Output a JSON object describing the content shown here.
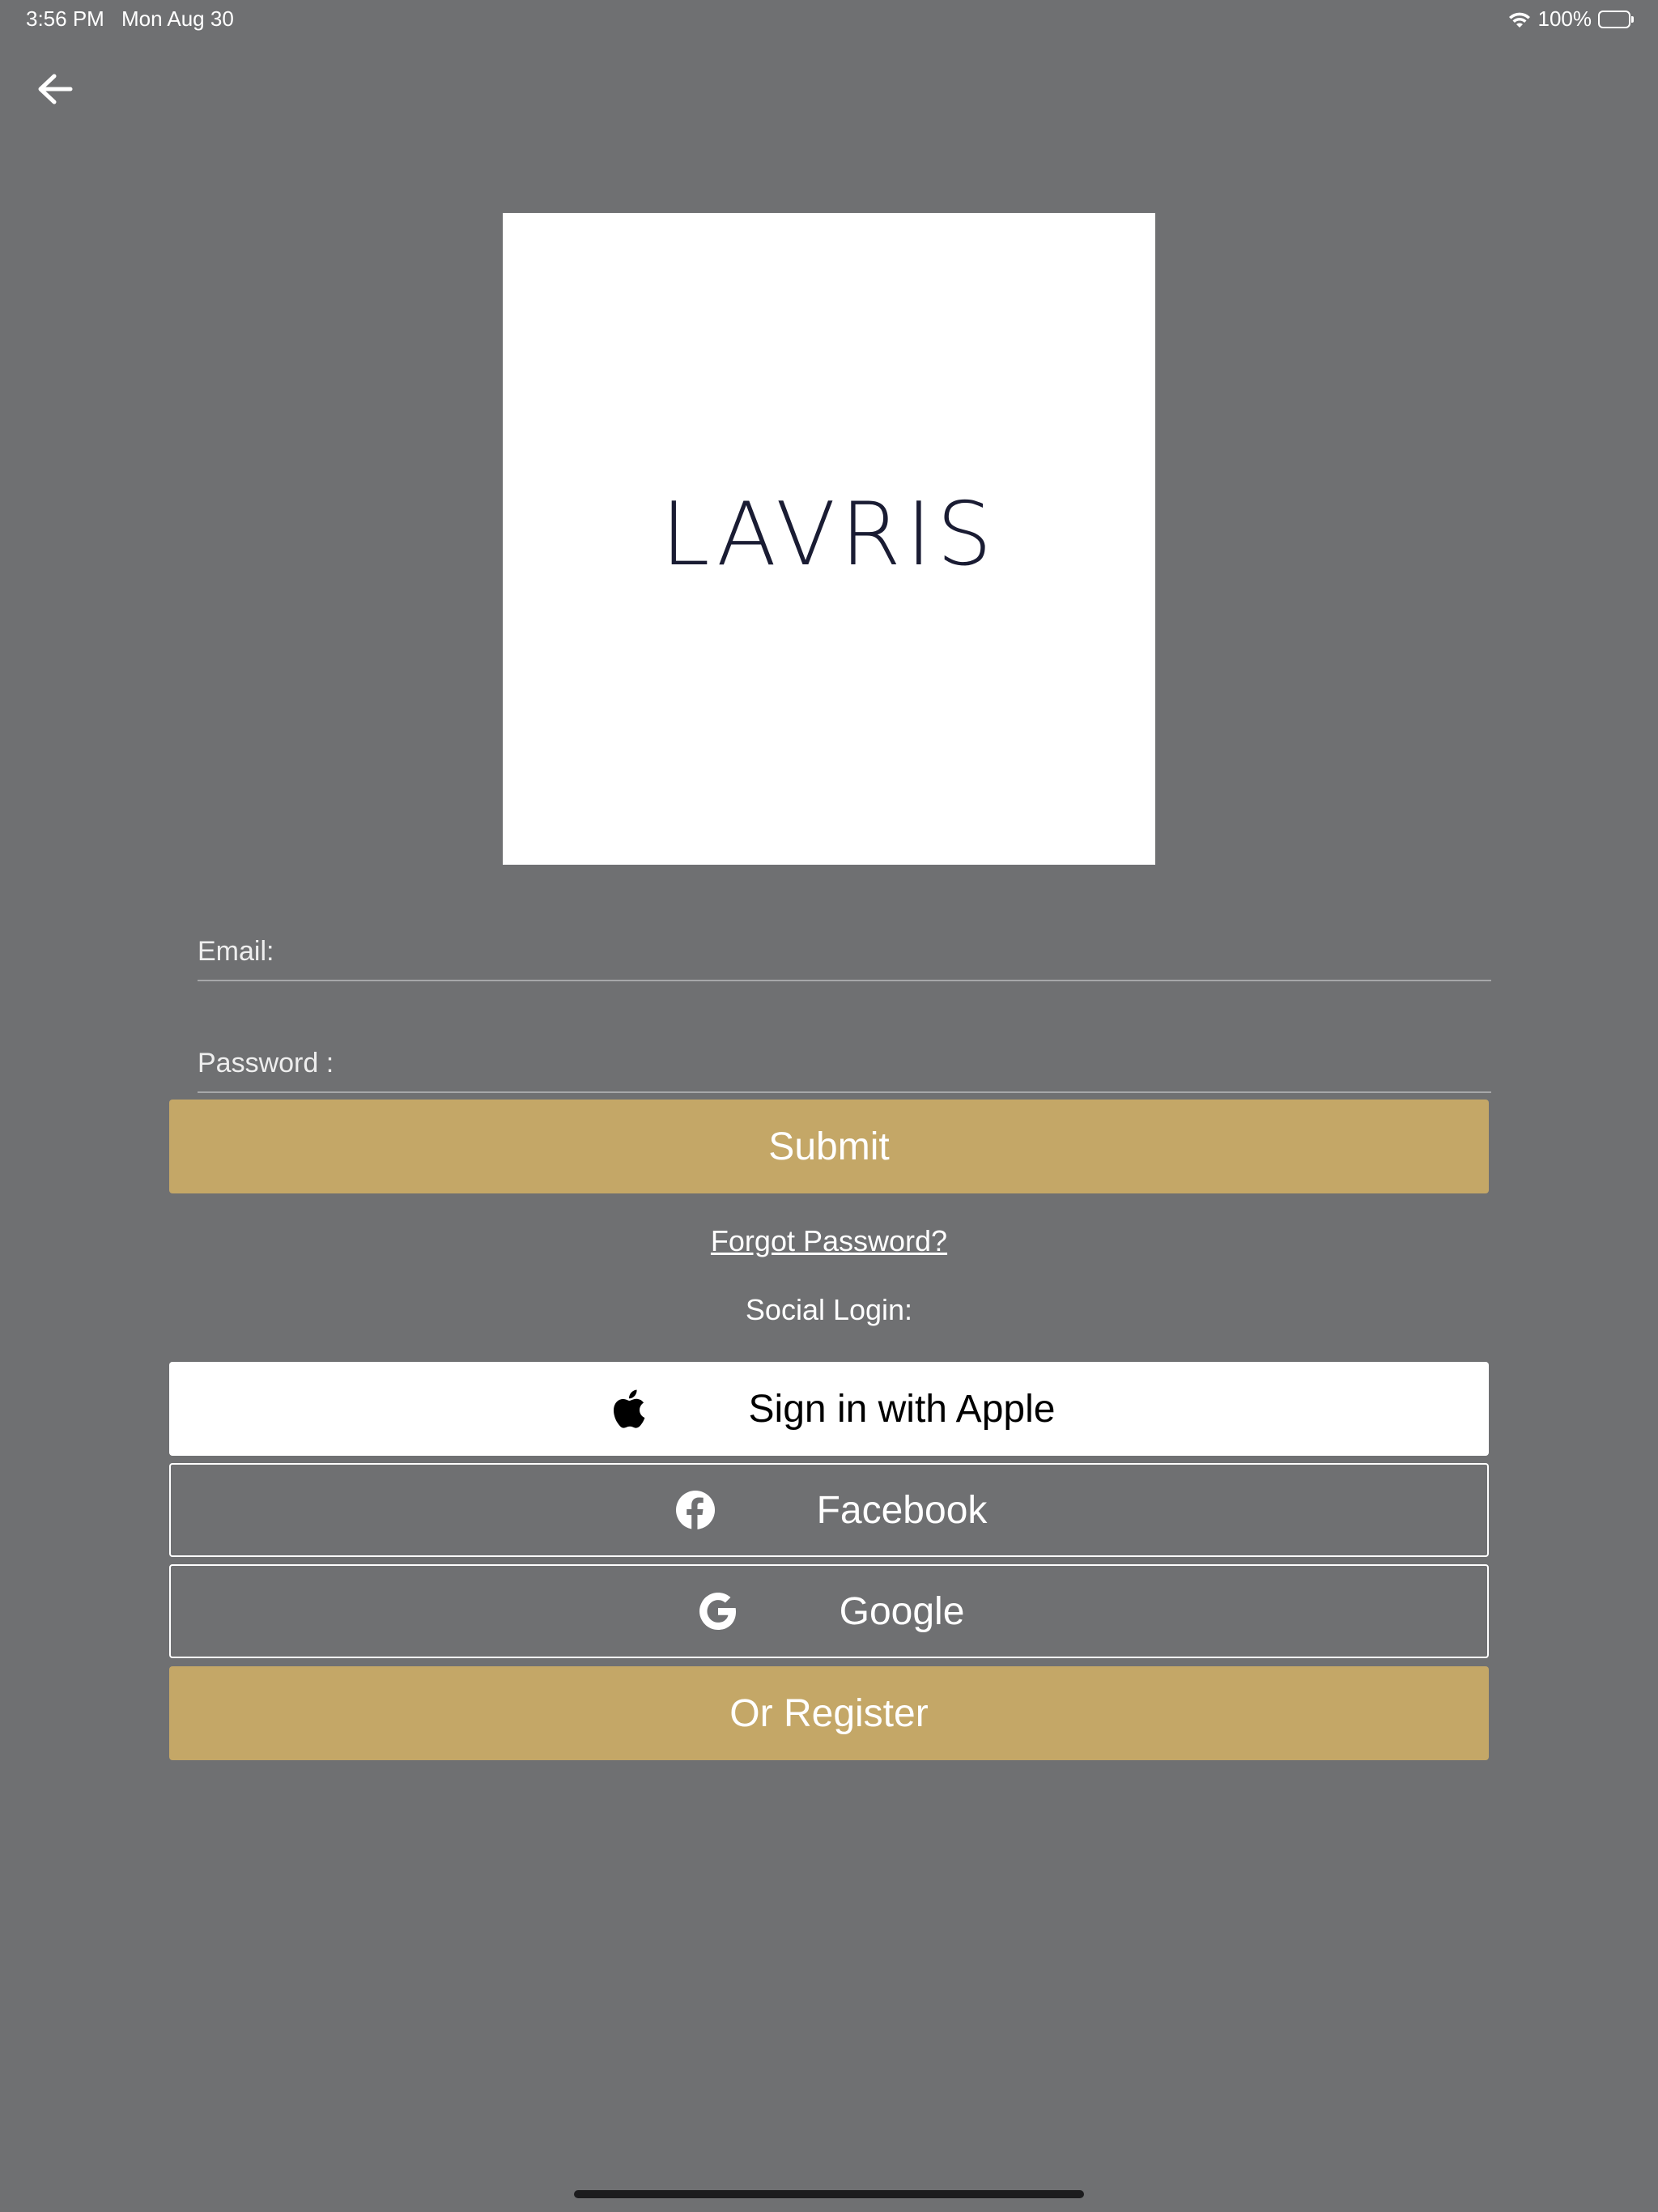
{
  "status_bar": {
    "time": "3:56 PM",
    "date": "Mon Aug 30",
    "battery": "100%",
    "wifi_icon": "wifi-icon",
    "battery_icon": "battery-icon"
  },
  "header": {
    "back_icon": "arrow-left-icon"
  },
  "logo": {
    "text": "LAVRIS"
  },
  "form": {
    "email_placeholder": "Email:",
    "email_value": "",
    "password_placeholder": "Password :",
    "password_value": "",
    "submit_label": "Submit",
    "forgot_password": "Forgot Password?"
  },
  "social": {
    "label": "Social Login:",
    "apple_label": "Sign in with Apple",
    "apple_icon": "apple-icon",
    "facebook_label": "Facebook",
    "facebook_icon": "facebook-icon",
    "google_label": "Google",
    "google_icon": "google-icon"
  },
  "register": {
    "label": "Or Register"
  },
  "colors": {
    "background": "#6f7072",
    "accent_gold": "#c4a767",
    "logo_text": "#1a1c33"
  }
}
